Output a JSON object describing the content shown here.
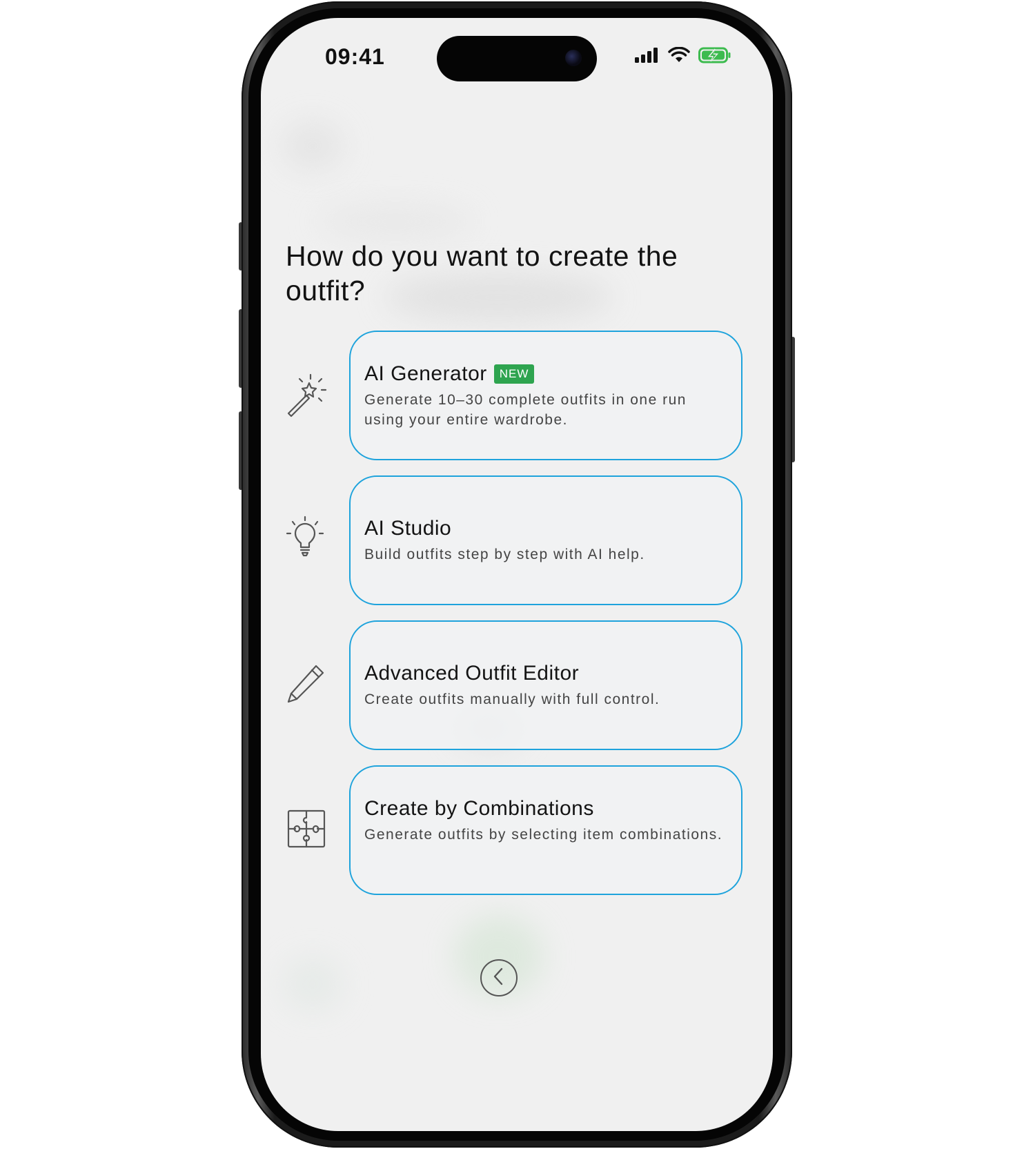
{
  "status_bar": {
    "time": "09:41",
    "signal_icon": "signal-bars-icon",
    "wifi_icon": "wifi-icon",
    "battery_icon": "battery-charging-icon",
    "battery_color": "#3dbb4f"
  },
  "page": {
    "title": "How do you want to create the outfit?"
  },
  "options": [
    {
      "icon": "magic-wand-icon",
      "title": "AI Generator",
      "badge": "NEW",
      "description": "Generate 10–30 complete outfits in one run using your entire wardrobe."
    },
    {
      "icon": "lightbulb-icon",
      "title": "AI Studio",
      "description": "Build outfits step by step with AI help."
    },
    {
      "icon": "pencil-icon",
      "title": "Advanced Outfit Editor",
      "description": "Create outfits manually with full control."
    },
    {
      "icon": "puzzle-icon",
      "title": "Create by Combinations",
      "description": "Generate outfits by selecting item combinations."
    }
  ],
  "navigation": {
    "back_icon": "chevron-left-icon"
  },
  "colors": {
    "card_border": "#1ea3dc",
    "badge_background": "#2ea44f",
    "screen_background": "#f0f0f0"
  }
}
